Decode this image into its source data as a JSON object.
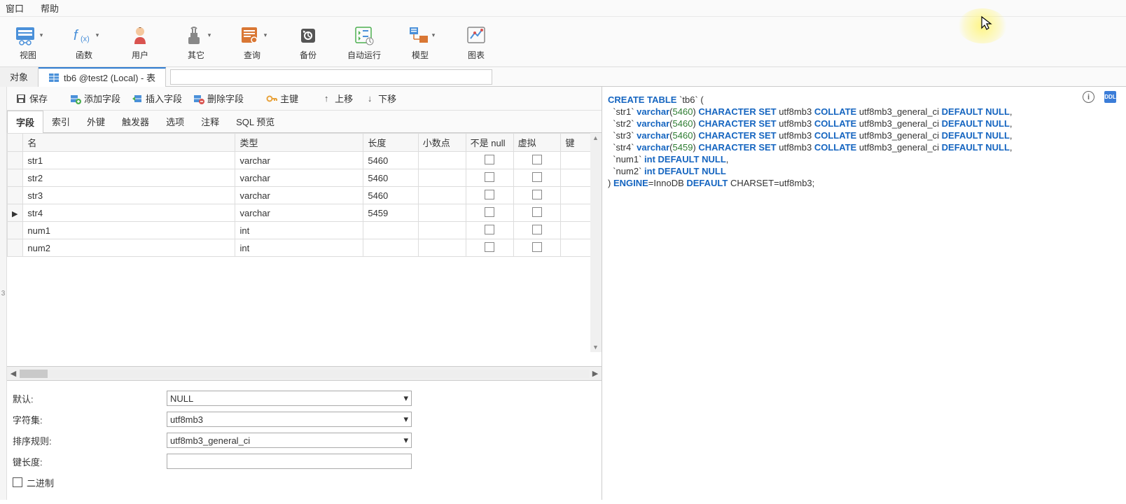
{
  "menubar": {
    "window": "窗口",
    "help": "帮助"
  },
  "toolbar": {
    "view": "视图",
    "function": "函数",
    "user": "用户",
    "other": "其它",
    "query": "查询",
    "backup": "备份",
    "autorun": "自动运行",
    "model": "模型",
    "chart": "图表"
  },
  "tabs": {
    "objects": "对象",
    "active": "tb6 @test2 (Local) - 表"
  },
  "actions": {
    "save": "保存",
    "add_field": "添加字段",
    "insert_field": "插入字段",
    "delete_field": "删除字段",
    "primary_key": "主键",
    "move_up": "上移",
    "move_down": "下移"
  },
  "sub_tabs": {
    "fields": "字段",
    "indexes": "索引",
    "foreign_keys": "外键",
    "triggers": "触发器",
    "options": "选项",
    "comments": "注释",
    "sql_preview": "SQL 预览"
  },
  "columns": {
    "name": "名",
    "type": "类型",
    "length": "长度",
    "decimal": "小数点",
    "not_null": "不是 null",
    "virtual": "虚拟",
    "key": "键"
  },
  "rows": [
    {
      "name": "str1",
      "type": "varchar",
      "length": "5460",
      "current": false
    },
    {
      "name": "str2",
      "type": "varchar",
      "length": "5460",
      "current": false
    },
    {
      "name": "str3",
      "type": "varchar",
      "length": "5460",
      "current": false
    },
    {
      "name": "str4",
      "type": "varchar",
      "length": "5459",
      "current": true
    },
    {
      "name": "num1",
      "type": "int",
      "length": "",
      "current": false
    },
    {
      "name": "num2",
      "type": "int",
      "length": "",
      "current": false
    }
  ],
  "props": {
    "default_label": "默认:",
    "default_value": "NULL",
    "charset_label": "字符集:",
    "charset_value": "utf8mb3",
    "collation_label": "排序规则:",
    "collation_value": "utf8mb3_general_ci",
    "keylen_label": "键长度:",
    "keylen_value": "",
    "binary_label": "二进制"
  },
  "ddl_badge": "DDL",
  "sql": {
    "l1a": "CREATE TABLE",
    "l1b": " `tb6` (",
    "cols": [
      {
        "name": "str1",
        "type": "varchar",
        "len": "5460"
      },
      {
        "name": "str2",
        "type": "varchar",
        "len": "5460"
      },
      {
        "name": "str3",
        "type": "varchar",
        "len": "5460"
      },
      {
        "name": "str4",
        "type": "varchar",
        "len": "5459"
      }
    ],
    "cs": "CHARACTER SET",
    "csv": " utf8mb3 ",
    "col": "COLLATE",
    "colv": " utf8mb3_general_ci ",
    "dn": "DEFAULT NULL",
    "num1": "  `num1` ",
    "num2": "  `num2` ",
    "int": "int",
    "dnc": " DEFAULT NULL",
    "end1": ") ",
    "eng": "ENGINE",
    "eq": "=",
    "inno": "InnoDB",
    "def": " DEFAULT",
    "end2": " CHARSET=utf8mb3;"
  }
}
